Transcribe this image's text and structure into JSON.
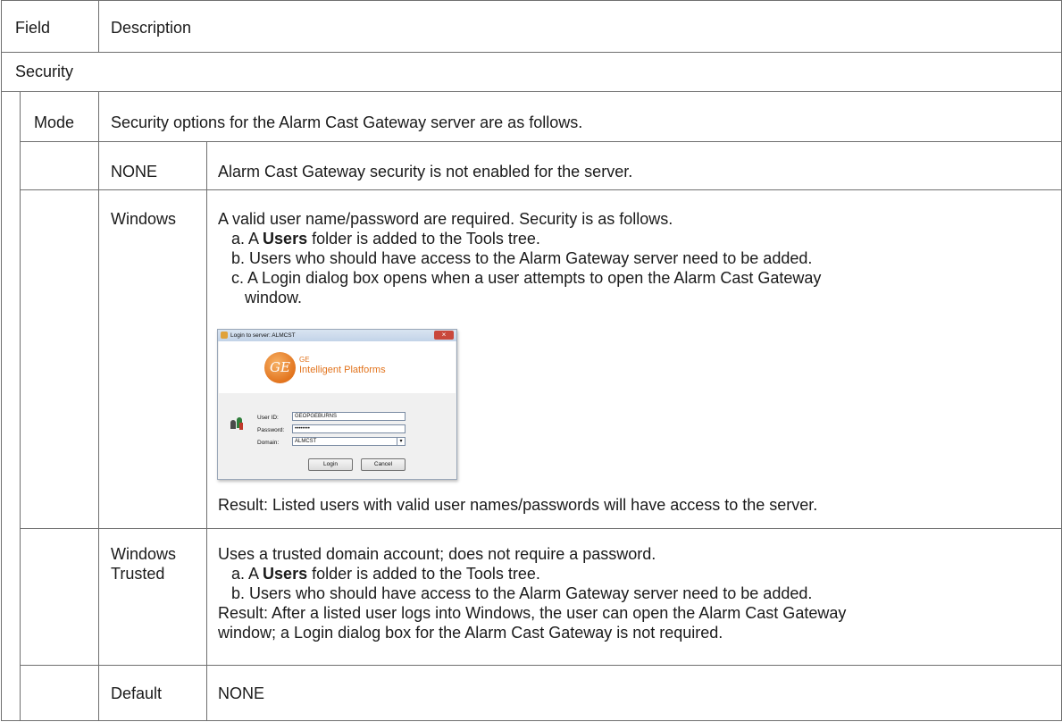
{
  "header": {
    "field": "Field",
    "description": "Description"
  },
  "section": "Security",
  "mode": {
    "field": "Mode",
    "description": "Security options for the Alarm Cast Gateway server are as follows."
  },
  "options": [
    {
      "name": "NONE",
      "description": "Alarm Cast Gateway security is not enabled for the server."
    },
    {
      "name": "Windows",
      "intro": "A valid user name/password are required. Security is as follows.",
      "steps": [
        {
          "prefix": "a. A ",
          "bold": "Users",
          "suffix": " folder is added to the Tools tree."
        },
        {
          "text": "b. Users who should have access to the Alarm Gateway server need to be added."
        },
        {
          "text": "c. A Login dialog box opens when a user attempts to open the Alarm Cast Gateway",
          "cont": "window."
        }
      ],
      "result": "Result: Listed  users with valid user names/passwords will have access to the server."
    },
    {
      "name_lines": [
        "Windows",
        "Trusted"
      ],
      "intro": "Uses a trusted domain account; does not require a password.",
      "steps": [
        {
          "prefix": "a. A ",
          "bold": "Users",
          "suffix": " folder is added to the Tools tree."
        },
        {
          "text": "b. Users who should have access to the Alarm Gateway server need to be added."
        }
      ],
      "result_lines": [
        "Result: After a listed user logs into Windows, the user can open the Alarm Cast Gateway",
        "window; a Login dialog box for the Alarm Cast Gateway  is not required."
      ]
    },
    {
      "name": "Default",
      "description": "NONE"
    }
  ],
  "login_dialog": {
    "title": "Login to server: ALMCST",
    "close": "×",
    "logo_mark": "GE",
    "brand_line1": "GE",
    "brand_line2": "Intelligent Platforms",
    "user_id_label": "User ID:",
    "user_id_value": "GEOPGEBURNS",
    "password_label": "Password:",
    "password_value": "••••••••",
    "domain_label": "Domain:",
    "domain_value": "ALMCST",
    "login_button": "Login",
    "cancel_button": "Cancel"
  }
}
